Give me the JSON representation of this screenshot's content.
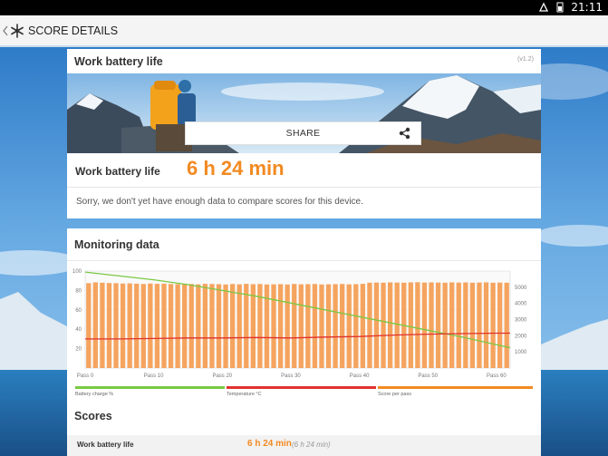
{
  "status_bar": {
    "time": "21:11"
  },
  "app_bar": {
    "title": "SCORE DETAILS"
  },
  "summary_card": {
    "title": "Work battery life",
    "version": "(v1.2)",
    "share_label": "SHARE",
    "score_label": "Work battery life",
    "score_value": "6 h 24 min",
    "note": "Sorry, we don't yet have enough data to compare scores for this device."
  },
  "monitoring_card": {
    "title": "Monitoring data",
    "legend": [
      "Battery charge %",
      "Temperature °C",
      "Score per pass"
    ],
    "scores_title": "Scores",
    "score_rows": [
      {
        "name": "Work battery life",
        "value": "6 h 24 min",
        "secondary": "(6 h 24 min)"
      }
    ]
  },
  "colors": {
    "accent_orange": "#f28a22",
    "battery_green": "#7ac943",
    "temperature_red": "#e0322e",
    "bar_orange": "#f5a45f"
  },
  "chart_data": {
    "type": "bar",
    "x_tick_labels": [
      "Pass 0",
      "Pass 10",
      "Pass 20",
      "Pass 30",
      "Pass 40",
      "Pass 50",
      "Pass 60"
    ],
    "x_ticks": [
      0,
      10,
      20,
      30,
      40,
      50,
      60
    ],
    "xlim": [
      0,
      62
    ],
    "left_axis": {
      "ticks": [
        20,
        40,
        60,
        80,
        100
      ],
      "ylim": [
        0,
        100
      ]
    },
    "right_axis": {
      "ticks": [
        1000,
        2000,
        3000,
        4000,
        5000
      ],
      "ylim": [
        0,
        6000
      ]
    },
    "series": [
      {
        "name": "Score per pass",
        "axis": "right",
        "kind": "bar",
        "x": [
          1,
          2,
          3,
          4,
          5,
          6,
          7,
          8,
          9,
          10,
          11,
          12,
          13,
          14,
          15,
          16,
          17,
          18,
          19,
          20,
          21,
          22,
          23,
          24,
          25,
          26,
          27,
          28,
          29,
          30,
          31,
          32,
          33,
          34,
          35,
          36,
          37,
          38,
          39,
          40,
          41,
          42,
          43,
          44,
          45,
          46,
          47,
          48,
          49,
          50,
          51,
          52,
          53,
          54,
          55,
          56,
          57,
          58,
          59,
          60,
          61,
          62
        ],
        "values": [
          5250,
          5300,
          5280,
          5260,
          5250,
          5230,
          5240,
          5220,
          5200,
          5230,
          5210,
          5220,
          5200,
          5190,
          5220,
          5200,
          5180,
          5210,
          5200,
          5190,
          5170,
          5200,
          5180,
          5210,
          5190,
          5200,
          5170,
          5180,
          5190,
          5170,
          5200,
          5180,
          5190,
          5200,
          5170,
          5180,
          5190,
          5200,
          5180,
          5190,
          5210,
          5280,
          5290,
          5280,
          5300,
          5290,
          5280,
          5300,
          5310,
          5290,
          5300,
          5290,
          5280,
          5300,
          5290,
          5300,
          5280,
          5290,
          5300,
          5280,
          5290,
          5280
        ]
      },
      {
        "name": "Battery charge %",
        "axis": "left",
        "kind": "line",
        "x": [
          0,
          5,
          10,
          15,
          20,
          25,
          30,
          35,
          40,
          45,
          50,
          55,
          60,
          62
        ],
        "values": [
          99,
          95,
          91,
          86,
          80,
          74,
          67,
          60,
          53,
          46,
          39,
          32,
          24,
          21
        ]
      },
      {
        "name": "Temperature °C",
        "axis": "left",
        "kind": "line",
        "x": [
          0,
          5,
          10,
          15,
          20,
          25,
          30,
          35,
          40,
          45,
          50,
          55,
          60,
          62
        ],
        "values": [
          30,
          30,
          30.5,
          31,
          31,
          31.5,
          31,
          32,
          32.5,
          34,
          35,
          35.5,
          36,
          36
        ]
      }
    ]
  }
}
